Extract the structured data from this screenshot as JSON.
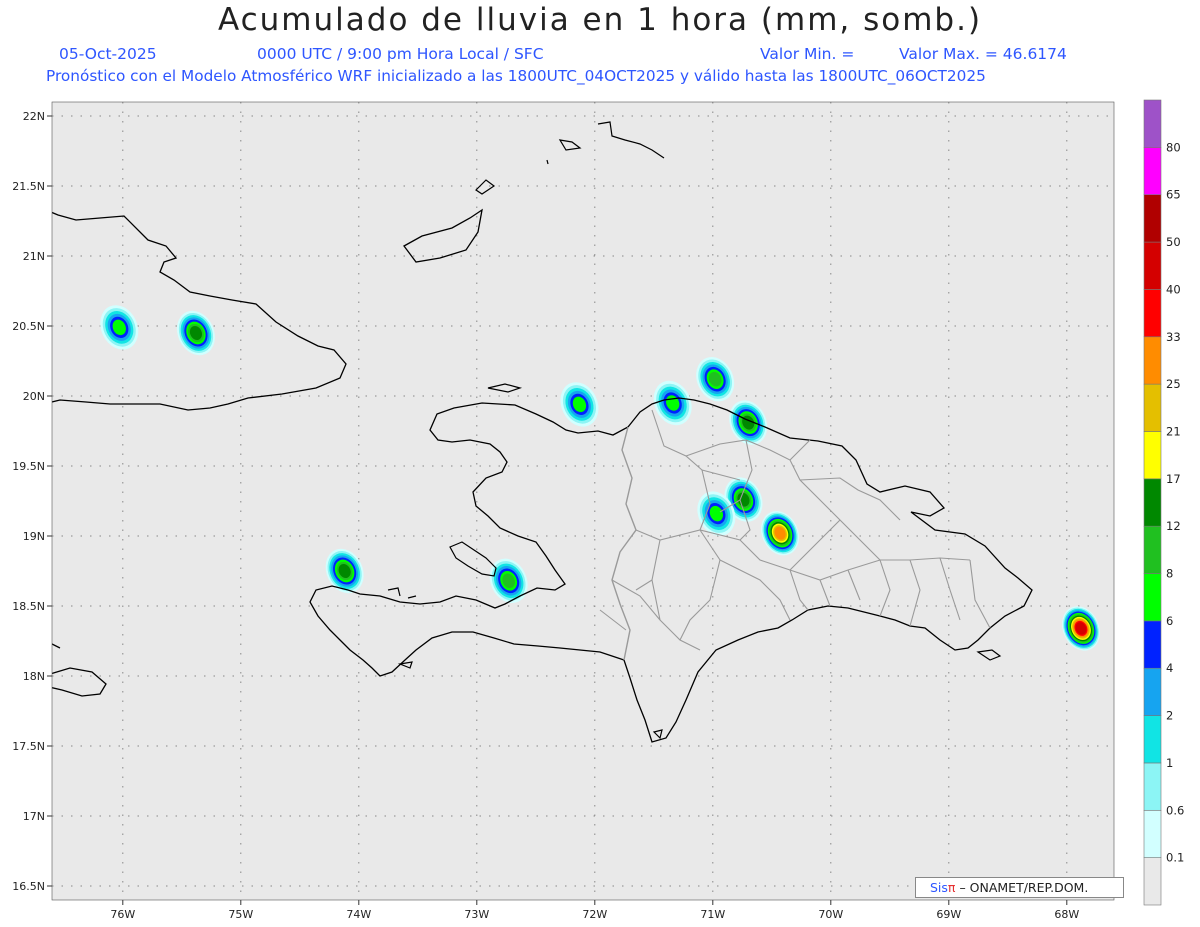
{
  "title": "Acumulado de lluvia en 1 hora (mm, somb.)",
  "subtitle_date": "05-Oct-2025",
  "subtitle_time": "0000 UTC / 9:00 pm Hora Local / SFC",
  "subtitle_min": "Valor Min. =",
  "subtitle_max": "Valor Max. = 46.6174",
  "subtitle_model": "Pronóstico con el Modelo Atmosférico WRF inicializado a las 1800UTC_04OCT2025 y válido hasta las  1800UTC_06OCT2025",
  "map": {
    "lon_range": [
      -76.6,
      -67.6
    ],
    "lat_range": [
      16.4,
      22.1
    ],
    "lon_ticks": [
      "76W",
      "75W",
      "74W",
      "73W",
      "72W",
      "71W",
      "70W",
      "69W",
      "68W"
    ],
    "lat_ticks": [
      "22N",
      "21.5N",
      "21N",
      "20.5N",
      "20N",
      "19.5N",
      "19N",
      "18.5N",
      "18N",
      "17.5N",
      "17N",
      "16.5N"
    ],
    "colors": {
      "background": "#e9e9e9",
      "coast": "#000000",
      "border": "#9a9a9a",
      "grid": "#888888"
    }
  },
  "legend": {
    "levels": [
      "0.1",
      "0.6",
      "1",
      "2",
      "4",
      "6",
      "8",
      "12",
      "17",
      "21",
      "25",
      "33",
      "40",
      "50",
      "65",
      "80"
    ],
    "colors": [
      "#e9e9e9",
      "#d2ffff",
      "#8cf5f5",
      "#11e4e4",
      "#16a4f0",
      "#0022ff",
      "#00ff00",
      "#20c020",
      "#008800",
      "#ffff00",
      "#e4bf00",
      "#ff8c00",
      "#ff0000",
      "#d40000",
      "#b00000",
      "#ff00ff",
      "#9e52c8"
    ]
  },
  "rain_cells": [
    {
      "name": "central-dr-cell",
      "lon": -70.43,
      "lat": 19.02,
      "max_mm": 25
    },
    {
      "name": "la-vega-cell",
      "lon": -70.74,
      "lat": 19.26,
      "max_mm": 12
    },
    {
      "name": "puerto-plata-cell",
      "lon": -70.98,
      "lat": 20.12,
      "max_mm": 8
    },
    {
      "name": "samana-west-cell",
      "lon": -70.7,
      "lat": 19.81,
      "max_mm": 12
    },
    {
      "name": "mona-passage-cell",
      "lon": -67.88,
      "lat": 18.34,
      "max_mm": 40
    },
    {
      "name": "eastern-cuba-cell",
      "lon": -75.38,
      "lat": 20.45,
      "max_mm": 12
    },
    {
      "name": "haiti-southwest-cell",
      "lon": -74.12,
      "lat": 18.75,
      "max_mm": 12
    },
    {
      "name": "gonave-east-cell",
      "lon": -72.73,
      "lat": 18.68,
      "max_mm": 8
    },
    {
      "name": "monte-cristi-cell",
      "lon": -71.34,
      "lat": 19.95,
      "max_mm": 6
    },
    {
      "name": "northwest-haiti-cell",
      "lon": -72.13,
      "lat": 19.94,
      "max_mm": 6
    },
    {
      "name": "cuba-west-cell",
      "lon": -76.03,
      "lat": 20.49,
      "max_mm": 6
    },
    {
      "name": "santiago-west-cell",
      "lon": -70.97,
      "lat": 19.16,
      "max_mm": 6
    }
  ],
  "credit": {
    "brand": "Sis",
    "symbol": "π",
    "text": "– ONAMET/REP.DOM."
  }
}
